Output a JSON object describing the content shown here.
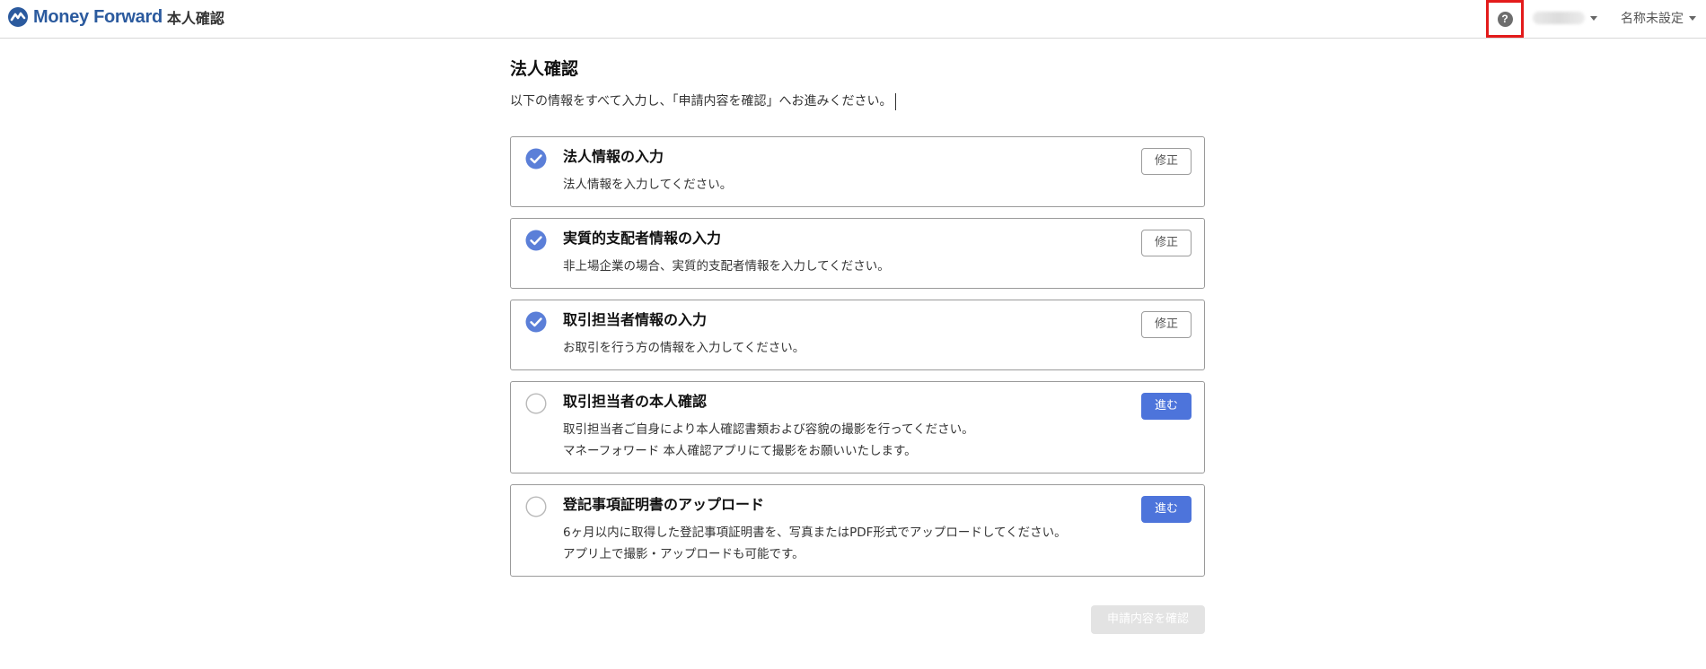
{
  "header": {
    "brand_name": "Money Forward",
    "service_name": "本人確認",
    "help_glyph": "?",
    "office_label": "名称未設定"
  },
  "main": {
    "title": "法人確認",
    "lead": "以下の情報をすべて入力し、「申請内容を確認」へお進みください。"
  },
  "steps": [
    {
      "title": "法人情報の入力",
      "desc1": "法人情報を入力してください。",
      "desc2": "",
      "completed": true,
      "button": "修正"
    },
    {
      "title": "実質的支配者情報の入力",
      "desc1": "非上場企業の場合、実質的支配者情報を入力してください。",
      "desc2": "",
      "completed": true,
      "button": "修正"
    },
    {
      "title": "取引担当者情報の入力",
      "desc1": "お取引を行う方の情報を入力してください。",
      "desc2": "",
      "completed": true,
      "button": "修正"
    },
    {
      "title": "取引担当者の本人確認",
      "desc1": "取引担当者ご自身により本人確認書類および容貌の撮影を行ってください。",
      "desc2": "マネーフォワード 本人確認アプリにて撮影をお願いいたします。",
      "completed": false,
      "button": "進む"
    },
    {
      "title": "登記事項証明書のアップロード",
      "desc1": "6ヶ月以内に取得した登記事項証明書を、写真またはPDF形式でアップロードしてください。",
      "desc2": "アプリ上で撮影・アップロードも可能です。",
      "completed": false,
      "button": "進む"
    }
  ],
  "footer": {
    "confirm_label": "申請内容を確認"
  },
  "colors": {
    "brand": "#2b5a9e",
    "accent": "#4d74db",
    "check": "#5b7fd8",
    "highlight_box": "#e31b1b"
  },
  "icons": {
    "logo": "money-forward-logo",
    "help": "help-icon",
    "completed": "check-circle-icon",
    "pending": "empty-circle-icon"
  }
}
